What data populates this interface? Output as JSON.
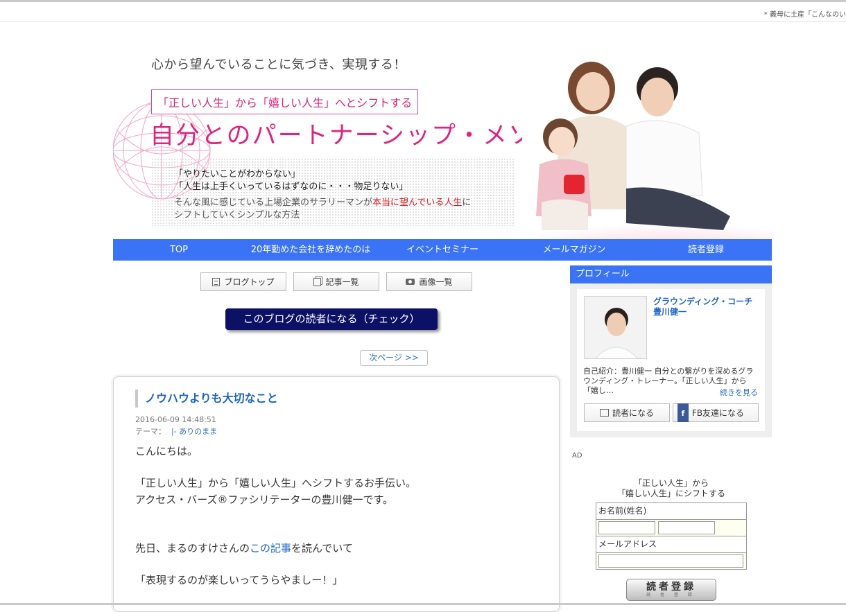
{
  "ticker": "* 義母に土産「こんなのい",
  "header": {
    "tagline": "心から望んでいることに気づき、実現する！",
    "pink_box": "「正しい人生」から「嬉しい人生」へとシフトする",
    "main_title": "自分とのパートナーシップ・メソッド",
    "quote1": "「やりたいことがわからない」",
    "quote2": "「人生は上手くいっているはずなのに・・・物足りない」",
    "desc1_a": "そんな風に感じている上場企業のサラリーマンが",
    "desc1_red": "本当に望んでいる人生",
    "desc1_b": "に",
    "desc2": "シフトしていくシンプルな方法"
  },
  "nav": [
    "TOP",
    "20年勤めた会社を辞めたのは",
    "イベントセミナー",
    "メールマガジン",
    "読者登録"
  ],
  "blog_buttons": {
    "top": "ブログトップ",
    "articles": "記事一覧",
    "images": "画像一覧"
  },
  "reader_button": "このブログの読者になる（チェック）",
  "next_page": "次ページ >>",
  "article": {
    "title": "ノウハウよりも大切なこと",
    "date": "2016-06-09 14:48:51",
    "theme_label": "テーマ：",
    "theme": "|- ありのまま",
    "p1": "こんにちは。",
    "p2": "「正しい人生」から「嬉しい人生」へシフトするお手伝い。",
    "p3": "アクセス・バーズ®ファシリテーターの豊川健一です。",
    "p4_a": "先日、まるのすけさんの",
    "p4_link": "この記事",
    "p4_b": "を読んでいて",
    "p5": "「表現するのが楽しいってうらやましー！」"
  },
  "sidebar": {
    "profile_head": "プロフィール",
    "profile_title1": "グラウンディング・コーチ",
    "profile_title2": "豊川健一",
    "profile_desc": "自己紹介：豊川健一 自分との繋がりを深めるグラウンディング・トレーナー。「正しい人生」から「嬉し…",
    "read_more": "続きを見る",
    "reader_btn": "読者になる",
    "fb_btn": "FB友達になる",
    "ad_label": "AD",
    "form_caption1": "「正しい人生」から",
    "form_caption2": "「嬉しい人生」にシフトする",
    "name_label": "お名前(姓名)",
    "email_label": "メールアドレス",
    "register_btn": "読者登録",
    "register_sub": "読 者 登 録"
  }
}
